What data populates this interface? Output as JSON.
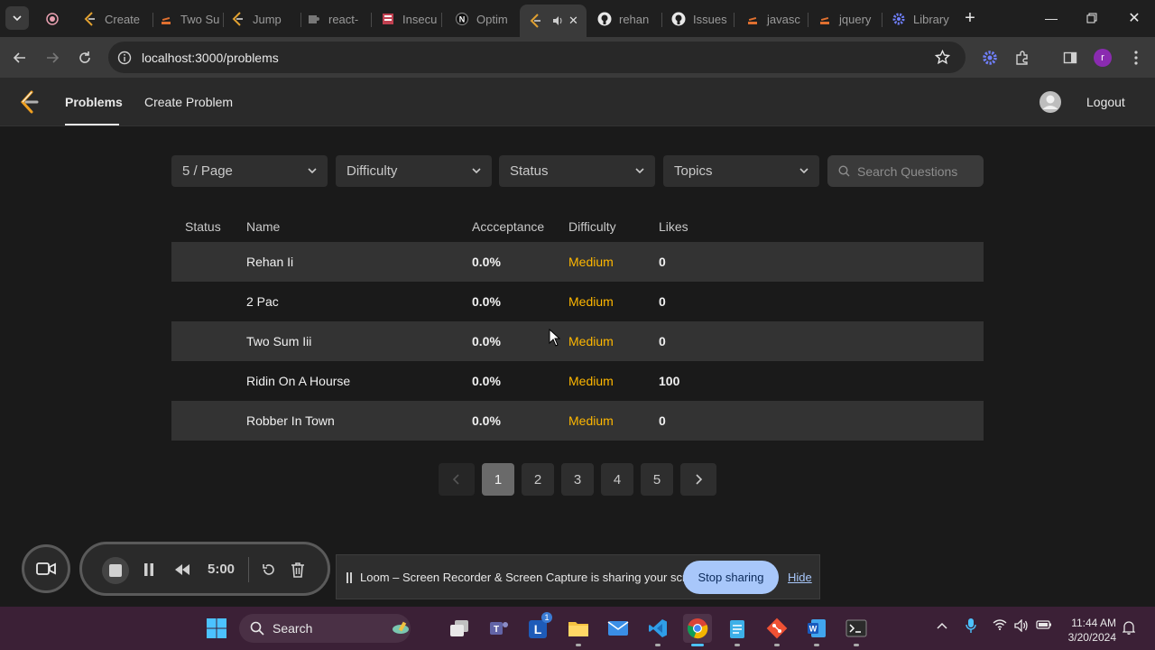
{
  "browser": {
    "tabs": [
      {
        "label": "",
        "icon": "loom-record-icon"
      },
      {
        "label": "Create",
        "icon": "leetcode-icon"
      },
      {
        "label": "Two Su",
        "icon": "stackoverflow-icon"
      },
      {
        "label": "Jump",
        "icon": "leetcode-icon"
      },
      {
        "label": "react-",
        "icon": "puzzle-icon"
      },
      {
        "label": "Insecu",
        "icon": "site-icon"
      },
      {
        "label": "Optim",
        "icon": "notion-icon"
      },
      {
        "label": "",
        "icon": "leetcode-icon",
        "active": true
      },
      {
        "label": "rehan",
        "icon": "github-icon"
      },
      {
        "label": "Issues",
        "icon": "github-icon"
      },
      {
        "label": "javasc",
        "icon": "stackoverflow-icon"
      },
      {
        "label": "jquery",
        "icon": "stackoverflow-icon"
      },
      {
        "label": "Library",
        "icon": "gear-icon"
      }
    ],
    "url": "localhost:3000/problems",
    "profile_initial": "r"
  },
  "app": {
    "nav": {
      "problems": "Problems",
      "create_problem": "Create Problem",
      "logout": "Logout"
    },
    "filters": {
      "page_size": "5 / Page",
      "difficulty": "Difficulty",
      "status": "Status",
      "topics": "Topics",
      "search_placeholder": "Search Questions"
    },
    "table": {
      "headers": {
        "status": "Status",
        "name": "Name",
        "acceptance": "Accceptance",
        "difficulty": "Difficulty",
        "likes": "Likes"
      },
      "rows": [
        {
          "name": "Rehan Ii",
          "acceptance": "0.0%",
          "difficulty": "Medium",
          "likes": "0"
        },
        {
          "name": "2 Pac",
          "acceptance": "0.0%",
          "difficulty": "Medium",
          "likes": "0"
        },
        {
          "name": "Two Sum Iii",
          "acceptance": "0.0%",
          "difficulty": "Medium",
          "likes": "0"
        },
        {
          "name": "Ridin On A Hourse",
          "acceptance": "0.0%",
          "difficulty": "Medium",
          "likes": "100"
        },
        {
          "name": "Robber In Town",
          "acceptance": "0.0%",
          "difficulty": "Medium",
          "likes": "0"
        }
      ]
    },
    "pagination": {
      "pages": [
        "1",
        "2",
        "3",
        "4",
        "5"
      ],
      "current": "1"
    },
    "colors": {
      "difficulty_medium": "#ffb800"
    }
  },
  "loom": {
    "timer": "5:00",
    "share_message": "Loom – Screen Recorder & Screen Capture is sharing your screen.",
    "stop_sharing": "Stop sharing",
    "hide": "Hide"
  },
  "taskbar": {
    "search_label": "Search",
    "time": "11:44 AM",
    "date": "3/20/2024",
    "teams_badge": "1"
  }
}
